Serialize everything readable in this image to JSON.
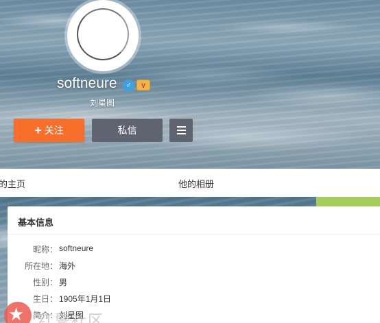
{
  "profile": {
    "username": "softneure",
    "real_name": "刘星图",
    "gender_symbol": "♂",
    "level_badge": "V"
  },
  "actions": {
    "follow_plus": "+",
    "follow_label": "关注",
    "message_label": "私信"
  },
  "tabs": [
    {
      "label": "的主页"
    },
    {
      "label": "他的相册"
    }
  ],
  "info_card": {
    "title": "基本信息",
    "rows": [
      {
        "label": "昵称：",
        "value": "softneure"
      },
      {
        "label": "所在地：",
        "value": "海外"
      },
      {
        "label": "性别：",
        "value": "男"
      },
      {
        "label": "生日：",
        "value": "1905年1月1日"
      },
      {
        "label": "简介：",
        "value": "刘星图"
      }
    ]
  },
  "watermark": {
    "text": "红警社区"
  },
  "colors": {
    "follow_button": "#f86f2c",
    "secondary_button": "#5f6470",
    "accent_green": "#a6cc5c",
    "gender_blue": "#3fa0e0"
  }
}
